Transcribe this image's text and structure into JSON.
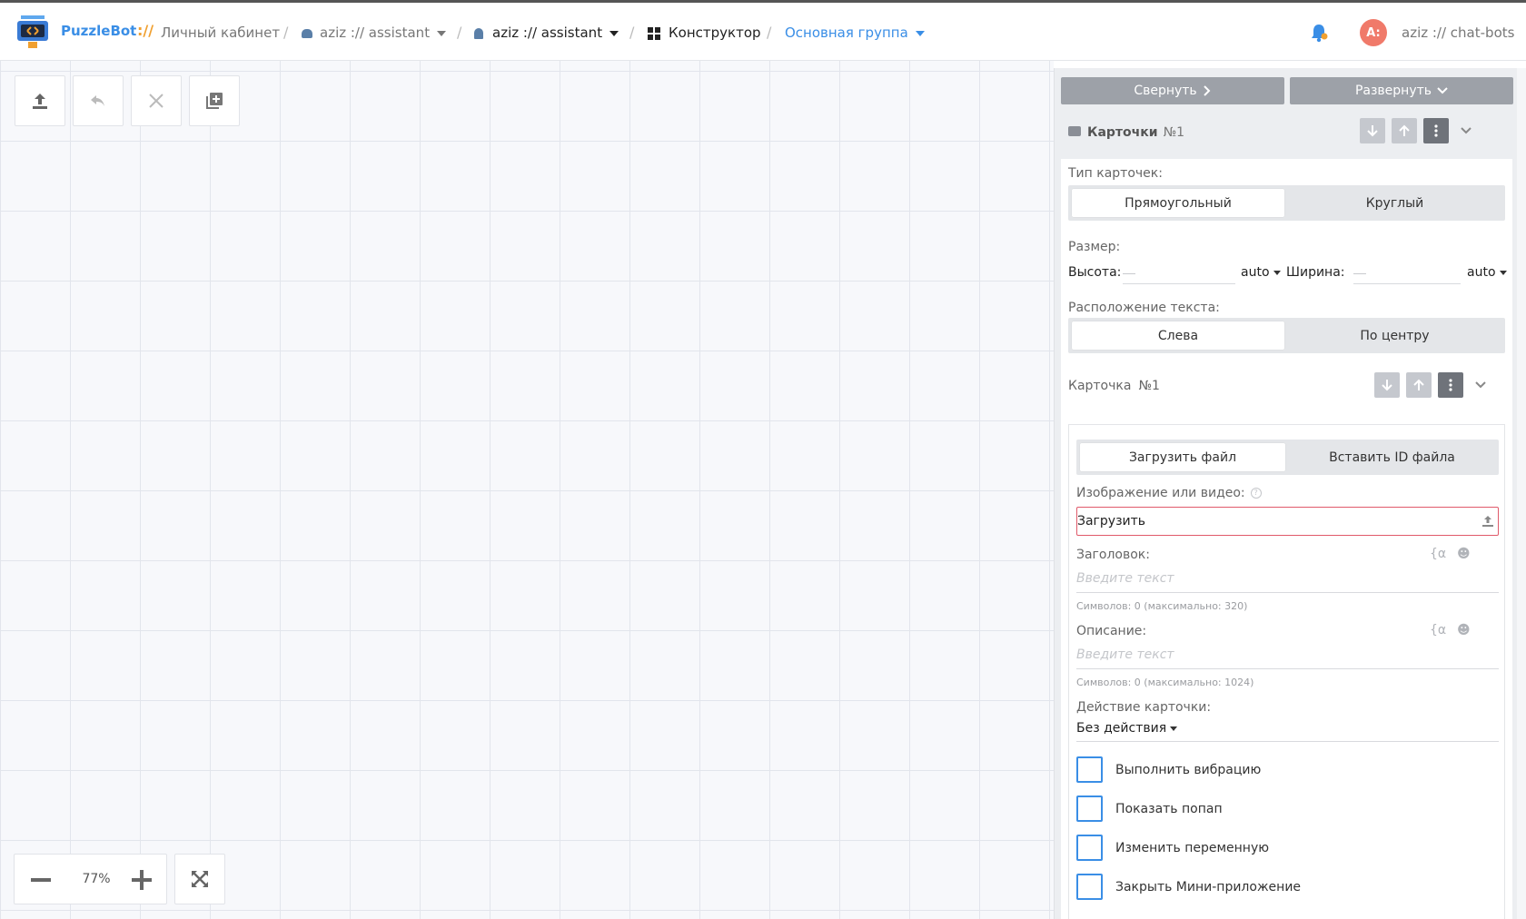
{
  "header": {
    "brand": "PuzzleBot",
    "brand_sep": "://",
    "crumb_cabinet": "Личный кабинет",
    "crumb_bot": "aziz :// assistant",
    "crumb_account": "aziz :// assistant",
    "crumb_constructor": "Конструктор",
    "crumb_group": "Основная группа",
    "avatar_initials": "A:",
    "user": "aziz :// chat-bots"
  },
  "toolbar": {
    "icons": [
      "upload-icon",
      "undo-icon",
      "close-icon",
      "add-block-icon"
    ]
  },
  "zoom": {
    "value": "77%"
  },
  "panel": {
    "collapse_label": "Свернуть",
    "expand_label": "Развернуть",
    "section_title": "Карточки",
    "section_num": "№1",
    "card_type_label": "Тип карточек:",
    "card_type_options": [
      "Прямоугольный",
      "Круглый"
    ],
    "size_label": "Размер:",
    "height_label": "Высота:",
    "height_unit": "auto",
    "width_label": "Ширина:",
    "width_unit": "auto",
    "text_pos_label": "Расположение текста:",
    "text_pos_options": [
      "Слева",
      "По центру"
    ],
    "card_title": "Карточка",
    "card_num": "№1",
    "file_tabs": [
      "Загрузить файл",
      "Вставить ID файла"
    ],
    "media_label": "Изображение или видео:",
    "upload_text": "Загрузить",
    "title_label": "Заголовок:",
    "title_placeholder": "Введите текст",
    "title_hint": "Символов: 0 (максимально: 320)",
    "desc_label": "Описание:",
    "desc_placeholder": "Введите текст",
    "desc_hint": "Символов: 0 (максимально: 1024)",
    "action_label": "Действие карточки:",
    "action_value": "Без действия",
    "checkboxes": [
      "Выполнить вибрацию",
      "Показать попап",
      "Изменить переменную",
      "Закрыть Мини-приложение"
    ]
  },
  "colors": {
    "accent": "#3a8ee6",
    "brand_sep": "#f0a030",
    "error_border": "#e05a6a",
    "avatar": "#f07a6a"
  }
}
